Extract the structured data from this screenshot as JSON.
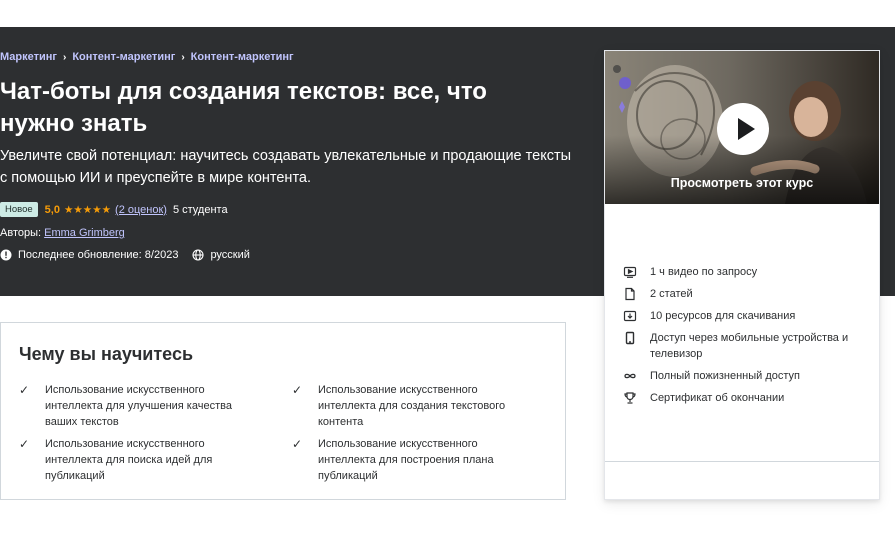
{
  "breadcrumb": [
    "Маркетинг",
    "Контент-маркетинг",
    "Контент-маркетинг"
  ],
  "title": "Чат-боты для создания текстов: все, что нужно знать",
  "subtitle": "Увеличте свой потенциал: научитесь создавать увлекательные и продающие тексты с помощью ИИ и преуспейте в мире контента.",
  "badge": "Новое",
  "rating": {
    "value": "5,0",
    "stars": "★★★★★",
    "reviews": "(2 оценок)",
    "students": "5 студента"
  },
  "authors": {
    "label": "Авторы:",
    "name": "Emma Grimberg"
  },
  "meta": {
    "updated": "Последнее обновление: 8/2023",
    "language": "русский"
  },
  "card": {
    "preview_caption": "Просмотреть этот курс",
    "includes": [
      {
        "icon": "video-icon",
        "text": "1 ч видео по запросу"
      },
      {
        "icon": "article-icon",
        "text": "2 статей"
      },
      {
        "icon": "download-icon",
        "text": "10 ресурсов для скачивания"
      },
      {
        "icon": "mobile-icon",
        "text": "Доступ через мобильные устройства и телевизор"
      },
      {
        "icon": "infinity-icon",
        "text": "Полный пожизненный доступ"
      },
      {
        "icon": "trophy-icon",
        "text": "Сертификат об окончании"
      }
    ]
  },
  "learn": {
    "title": "Чему вы научитесь",
    "items": [
      "Использование искусственного интеллекта для улучшения качества ваших текстов",
      "Использование искусственного интеллекта для создания текстового контента",
      "Использование искусственного интеллекта для поиска идей для публикаций",
      "Использование искусственного интеллекта для построения плана публикаций"
    ]
  },
  "colors": {
    "hero_bg": "#2d2f31",
    "link": "#c0c4fc",
    "star": "#f69c08",
    "badge_bg": "#cdebe5"
  }
}
